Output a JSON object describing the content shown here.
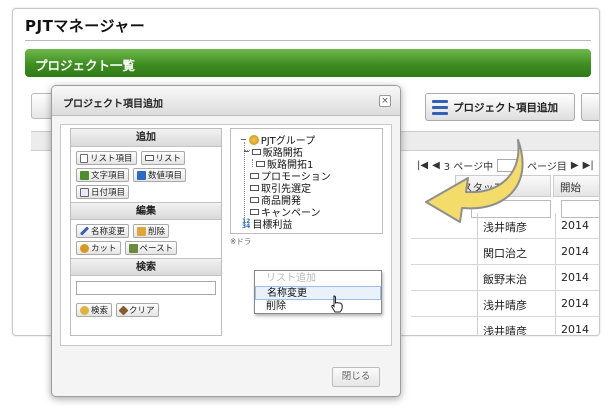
{
  "app": {
    "title": "PJTマネージャー",
    "page_title": "プロジェクト一覧",
    "add_item_button": "プロジェクト項目追加"
  },
  "grid": {
    "pager_text": "3 ページ中",
    "pager_suffix": "ページ目",
    "column_staff": "スタッフ",
    "column_start": "開始",
    "rows": [
      {
        "staff": "浅井晴彦",
        "year": "2014"
      },
      {
        "staff": "関口治之",
        "year": "2014"
      },
      {
        "staff": "飯野末治",
        "year": "2014"
      },
      {
        "staff": "浅井晴彦",
        "year": "2014"
      },
      {
        "staff": "浅井晴彦",
        "year": "2014"
      }
    ]
  },
  "dialog": {
    "title": "プロジェクト項目追加",
    "close_x": "×",
    "sections": {
      "add": "追加",
      "edit": "編集",
      "search": "検索"
    },
    "add_buttons": {
      "list_item": "リスト項目",
      "list": "リスト",
      "text_item": "文字項目",
      "number_item": "数値項目",
      "date_item": "日付項目"
    },
    "edit_buttons": {
      "rename": "名称変更",
      "delete": "削除",
      "cut": "カット",
      "paste": "ペースト"
    },
    "search_buttons": {
      "search": "検索",
      "clear": "クリア"
    },
    "tree": {
      "root": "PJTグループ",
      "items": {
        "sales_dev": "販路開拓",
        "sales_dev_1": "販路開拓1",
        "promotion": "プロモーション",
        "client_selection": "取引先選定",
        "product_dev": "商品開発",
        "campaign": "キャンペーン",
        "target_profit": "目標利益"
      },
      "num_icon_top": "12",
      "num_icon_bottom": "34"
    },
    "note": "※ドラ",
    "context_menu": {
      "add_list": "リスト追加",
      "rename": "名称変更",
      "delete": "削除"
    },
    "close_button": "閉じる"
  },
  "colors": {
    "header_green": "#3f8e21",
    "arrow_yellow": "#f3dc6a"
  }
}
